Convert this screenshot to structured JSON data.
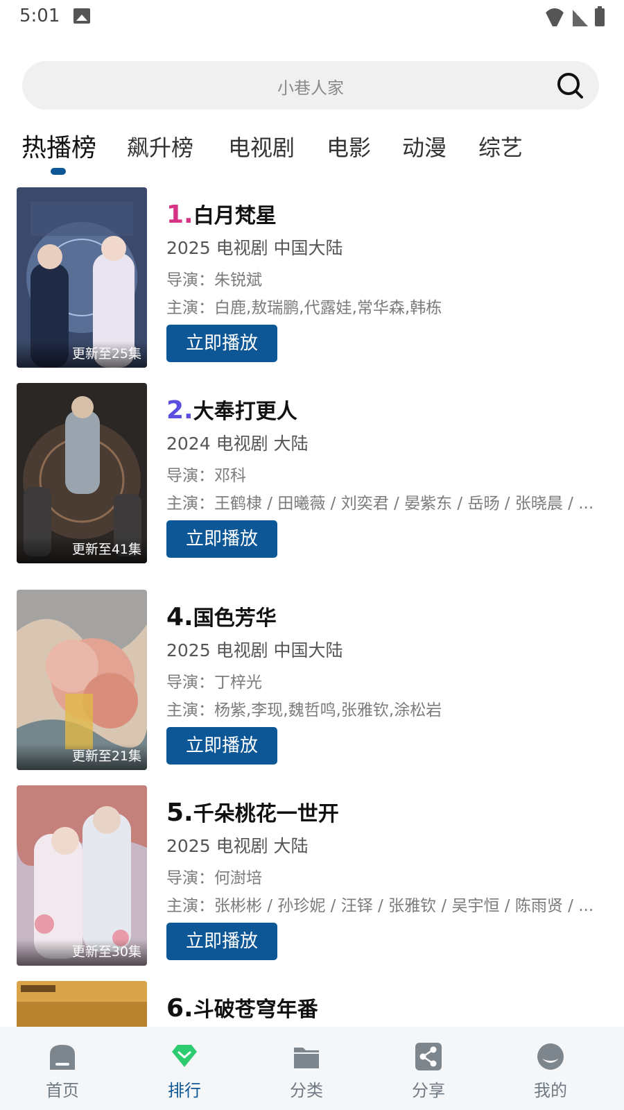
{
  "status_bar": {
    "time": "5:01"
  },
  "search": {
    "placeholder": "小巷人家"
  },
  "tabs": [
    {
      "label": "热播榜",
      "active": true
    },
    {
      "label": "飙升榜",
      "active": false
    },
    {
      "label": "电视剧",
      "active": false
    },
    {
      "label": "电影",
      "active": false
    },
    {
      "label": "动漫",
      "active": false
    },
    {
      "label": "综艺",
      "active": false
    }
  ],
  "action_label": "立即播放",
  "items": [
    {
      "rank": "1.",
      "rank_color": "#d63384",
      "title": "白月梵星",
      "meta": "2025  电视剧  中国大陆",
      "director": "导演：朱锐斌",
      "cast": "主演：白鹿,敖瑞鹏,代露娃,常华森,韩栋",
      "badge": "更新至25集"
    },
    {
      "rank": "2.",
      "rank_color": "#5b4fe0",
      "title": "大奉打更人",
      "meta": "2024  电视剧  大陆",
      "director": "导演：邓科",
      "cast": "主演：王鹤棣 / 田曦薇 / 刘奕君 / 晏紫东 / 岳旸 / 张晓晨 / ...",
      "badge": "更新至41集"
    },
    {
      "rank": "4.",
      "rank_color": "#111111",
      "title": "国色芳华",
      "meta": "2025  电视剧  中国大陆",
      "director": "导演：丁梓光",
      "cast": "主演：杨紫,李现,魏哲鸣,张雅钦,涂松岩",
      "badge": "更新至21集"
    },
    {
      "rank": "5.",
      "rank_color": "#111111",
      "title": "千朵桃花一世开",
      "meta": "2025  电视剧  大陆",
      "director": "导演：何澍培",
      "cast": "主演：张彬彬 / 孙珍妮 / 汪铎 / 张雅钦 / 吴宇恒 / 陈雨贤 / ...",
      "badge": "更新至30集"
    },
    {
      "rank": "6.",
      "rank_color": "#111111",
      "title": "斗破苍穹年番",
      "meta": "",
      "director": "",
      "cast": "",
      "badge": ""
    }
  ],
  "nav": [
    {
      "label": "首页",
      "icon": "home-icon",
      "active": false
    },
    {
      "label": "排行",
      "icon": "rank-icon",
      "active": true
    },
    {
      "label": "分类",
      "icon": "folder-icon",
      "active": false
    },
    {
      "label": "分享",
      "icon": "share-icon",
      "active": false
    },
    {
      "label": "我的",
      "icon": "profile-icon",
      "active": false
    }
  ],
  "colors": {
    "accent": "#0e5796",
    "active_nav_icon": "#2ecc71"
  }
}
